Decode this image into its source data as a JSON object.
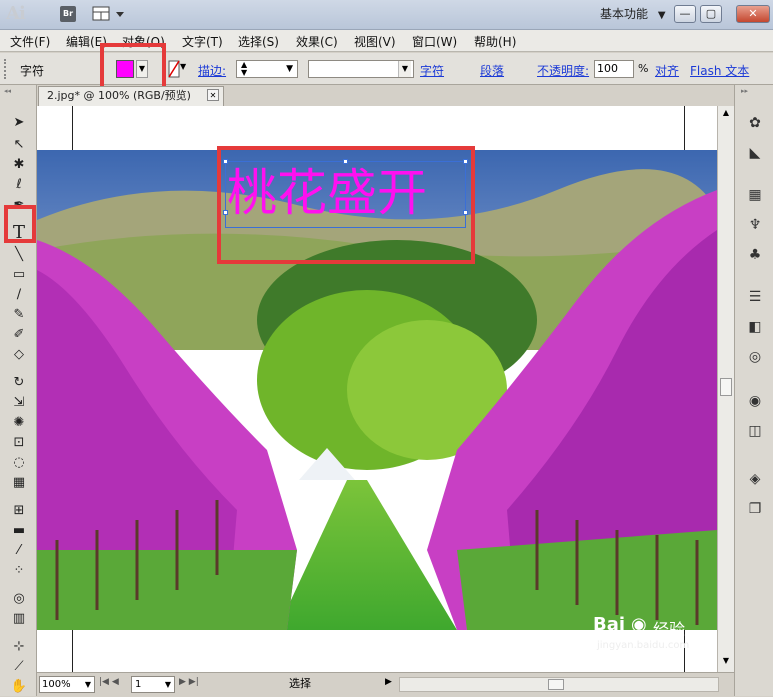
{
  "app": {
    "logo": "Ai",
    "bridge_label": "Br",
    "workspace_label": "基本功能",
    "window_buttons": [
      "—",
      "▢",
      "✕"
    ]
  },
  "menus": [
    "文件(F)",
    "编辑(E)",
    "对象(O)",
    "文字(T)",
    "选择(S)",
    "效果(C)",
    "视图(V)",
    "窗口(W)",
    "帮助(H)"
  ],
  "control_bar": {
    "mode_label": "字符",
    "fill_color": "#ff00ff",
    "stroke_label": "描边:",
    "char_link": "字符",
    "para_link": "段落",
    "opacity_label": "不透明度:",
    "opacity_value": "100",
    "opacity_unit": "%",
    "align_link": "对齐",
    "flash_link": "Flash 文本"
  },
  "document": {
    "tab_title": "2.jpg* @ 100% (RGB/预览)",
    "tab_close": "✕",
    "headline_text": "桃花盛开",
    "headline_color": "#ff10f0"
  },
  "status": {
    "zoom": "100%",
    "page": "1",
    "tool_status": "选择"
  },
  "watermark": {
    "brand": "Bai",
    "brand_icon": "paw-icon",
    "brand_suffix": "经验",
    "url": "jingyan.baidu.com"
  },
  "colors": {
    "highlight": "#e53a3a",
    "link": "#1c3ad6"
  }
}
